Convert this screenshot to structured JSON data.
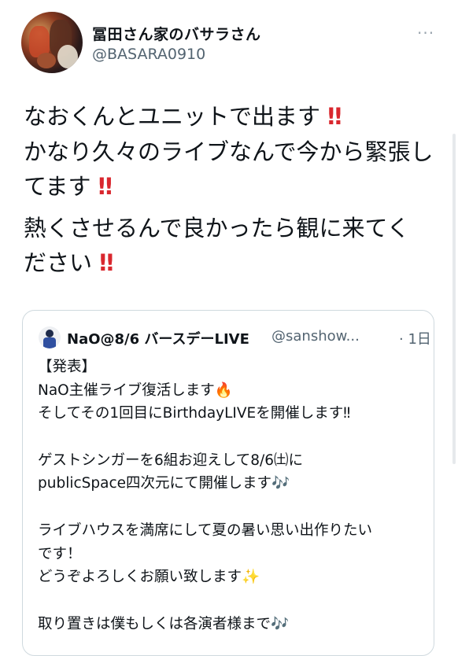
{
  "tweet": {
    "display_name": "冨田さん家のバサラさん",
    "handle": "@BASARA0910",
    "more_icon": "···",
    "lines": [
      {
        "text": "なおくんとユニットで出ます",
        "emoji": "‼"
      },
      {
        "text": "かなり久々のライブなんで今から緊張し",
        "emoji": ""
      },
      {
        "text": "てます",
        "emoji": "‼"
      },
      {
        "text": "熱くさせるんで良かったら観に来てく",
        "emoji": ""
      },
      {
        "text": "ださい",
        "emoji": "‼"
      }
    ]
  },
  "quoted": {
    "name": "NaO@8/6 バースデーLIVE",
    "handle": "@sanshow...",
    "time": "· 1日",
    "lines": [
      "【発表】",
      "NaO主催ライブ復活します🔥",
      "そしてその1回目にBirthdayLIVEを開催します‼",
      "",
      "ゲストシンガーを6組お迎えして8/6㈯に",
      "publicSpace四次元にて開催します🎶",
      "",
      "ライブハウスを満席にして夏の暑い思い出作りたい",
      "です！",
      "どうぞよろしくお願い致します✨",
      "",
      "取り置きは僕もしくは各演者様まで🎶"
    ]
  }
}
